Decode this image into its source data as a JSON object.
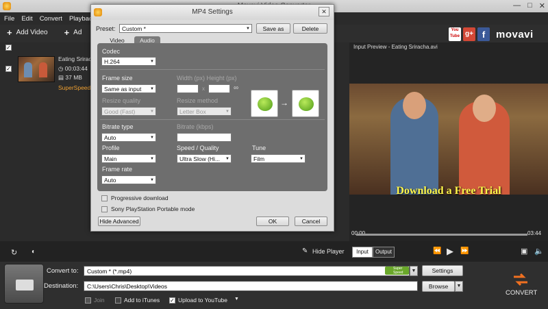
{
  "window": {
    "title": "Movavi Video Converter"
  },
  "menu": [
    "File",
    "Edit",
    "Convert",
    "Playback"
  ],
  "toolbar": {
    "add_video": "Add Video",
    "add_more": "Ad"
  },
  "social": {
    "youtube": "You Tube",
    "gplus": "g+",
    "facebook": "f",
    "brand": "movavi"
  },
  "file": {
    "name": "Eating Sriracha.avi",
    "name_short": "Eating Srirac",
    "duration": "00:03:44",
    "size": "37 MB",
    "badge": "SuperSpeed"
  },
  "preview": {
    "title": "Input Preview - Eating Sriracha.avi",
    "promo": "Download a Free Trial",
    "time_start": "00:00",
    "time_end": "03:44",
    "progress": 0.0
  },
  "controls": {
    "hide_player": "Hide Player",
    "input": "Input",
    "output": "Output"
  },
  "bottom": {
    "convert_to_label": "Convert to:",
    "convert_to_value": "Custom * (*.mp4)",
    "superspeed": "Super Speed",
    "settings": "Settings",
    "destination_label": "Destination:",
    "destination_value": "C:\\Users\\Chris\\Desktop\\Videos",
    "browse": "Browse",
    "join": "Join",
    "add_itunes": "Add to iTunes",
    "upload_youtube": "Upload to YouTube",
    "convert": "CONVERT"
  },
  "dialog": {
    "title": "MP4 Settings",
    "preset_label": "Preset:",
    "preset_value": "Custom *",
    "save_as": "Save as",
    "delete": "Delete",
    "tabs": [
      "Video",
      "Audio"
    ],
    "codec_label": "Codec",
    "codec_value": "H.264",
    "frame_size_label": "Frame size",
    "frame_size_value": "Same as input",
    "width_height_label": "Width (px) Height (px)",
    "x": "x",
    "resize_quality_label": "Resize quality",
    "resize_quality_value": "Good (Fast)",
    "resize_method_label": "Resize method",
    "resize_method_value": "Letter Box",
    "bitrate_type_label": "Bitrate type",
    "bitrate_type_value": "Auto",
    "bitrate_label": "Bitrate (kbps)",
    "profile_label": "Profile",
    "profile_value": "Main",
    "speed_label": "Speed / Quality",
    "speed_value": "Ultra Slow (Hi...",
    "tune_label": "Tune",
    "tune_value": "Film",
    "frame_rate_label": "Frame rate",
    "frame_rate_value": "Auto",
    "progressive": "Progressive download",
    "psp": "Sony PlayStation Portable mode",
    "hide_advanced": "Hide Advanced",
    "ok": "OK",
    "cancel": "Cancel",
    "arrow": "→"
  }
}
